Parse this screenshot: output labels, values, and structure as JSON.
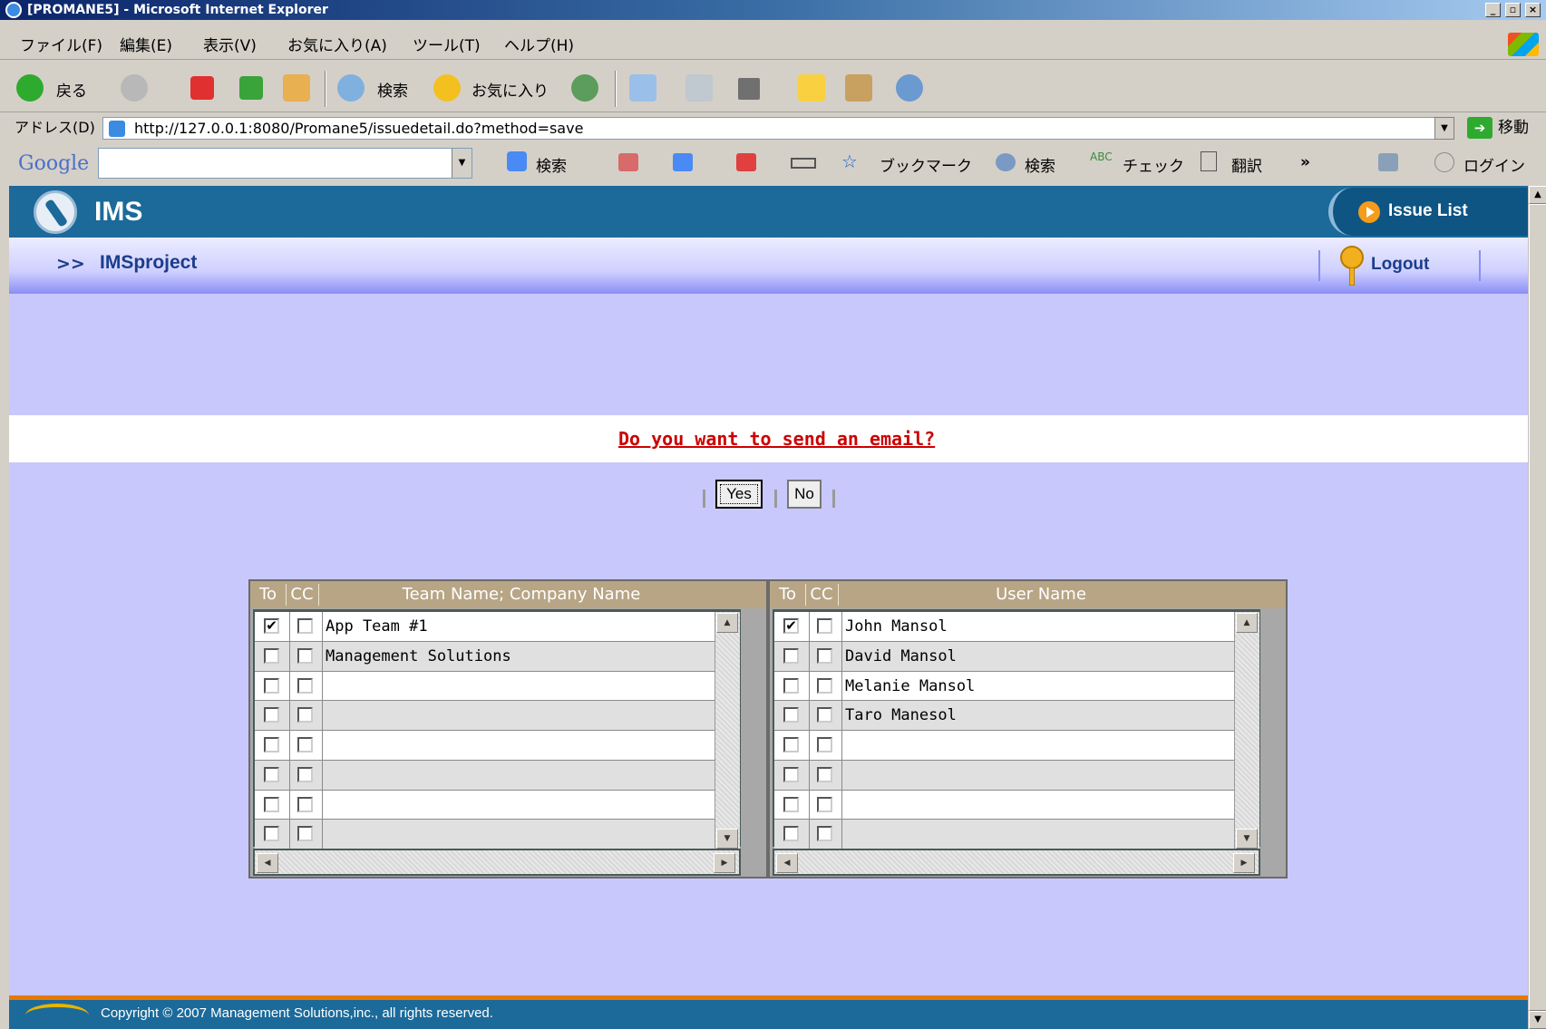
{
  "window": {
    "title": "[PROMANE5] - Microsoft Internet Explorer",
    "min_label": "_",
    "max_label": "▫",
    "close_label": "×"
  },
  "menu": [
    "ファイル(F)",
    "編集(E)",
    "表示(V)",
    "お気に入り(A)",
    "ツール(T)",
    "ヘルプ(H)"
  ],
  "toolbar": {
    "back_label": "戻る",
    "search_label": "検索",
    "favorites_label": "お気に入り"
  },
  "address": {
    "label": "アドレス(D)",
    "url": "http://127.0.0.1:8080/Promane5/issuedetail.do?method=save",
    "go_label": "移動"
  },
  "googlebar": {
    "logo": "Google",
    "search_label": "検索",
    "bookmark_label": "ブックマーク",
    "search2_label": "検索",
    "check_label": "チェック",
    "translate_label": "翻訳",
    "more_label": "»",
    "login_label": "ログイン"
  },
  "app": {
    "name": "IMS",
    "issue_list_label": "Issue List",
    "breadcrumb_arrow": ">>",
    "project_name": "IMSproject",
    "logout_label": "Logout"
  },
  "dialog": {
    "question": "Do you want to send an email?",
    "yes_label": "Yes",
    "no_label": "No"
  },
  "teams_grid": {
    "headers": [
      "To",
      "CC",
      "Team Name; Company Name"
    ],
    "rows": [
      {
        "to": true,
        "cc": false,
        "name": "App Team #1"
      },
      {
        "to": false,
        "cc": false,
        "name": "Management Solutions"
      },
      {
        "to": false,
        "cc": false,
        "name": ""
      },
      {
        "to": false,
        "cc": false,
        "name": ""
      },
      {
        "to": false,
        "cc": false,
        "name": ""
      },
      {
        "to": false,
        "cc": false,
        "name": ""
      },
      {
        "to": false,
        "cc": false,
        "name": ""
      },
      {
        "to": false,
        "cc": false,
        "name": ""
      }
    ]
  },
  "users_grid": {
    "headers": [
      "To",
      "CC",
      "User Name"
    ],
    "rows": [
      {
        "to": true,
        "cc": false,
        "name": "John Mansol"
      },
      {
        "to": false,
        "cc": false,
        "name": "David Mansol"
      },
      {
        "to": false,
        "cc": false,
        "name": "Melanie Mansol"
      },
      {
        "to": false,
        "cc": false,
        "name": "Taro Manesol"
      },
      {
        "to": false,
        "cc": false,
        "name": ""
      },
      {
        "to": false,
        "cc": false,
        "name": ""
      },
      {
        "to": false,
        "cc": false,
        "name": ""
      },
      {
        "to": false,
        "cc": false,
        "name": ""
      }
    ]
  },
  "footer": {
    "copyright": "Copyright © 2007  Management Solutions,inc., all rights reserved."
  },
  "colors": {
    "header_blue": "#1b6a9a",
    "page_bg": "#c8c8fd",
    "grid_header": "#b7a585",
    "question_red": "#cc0000"
  }
}
